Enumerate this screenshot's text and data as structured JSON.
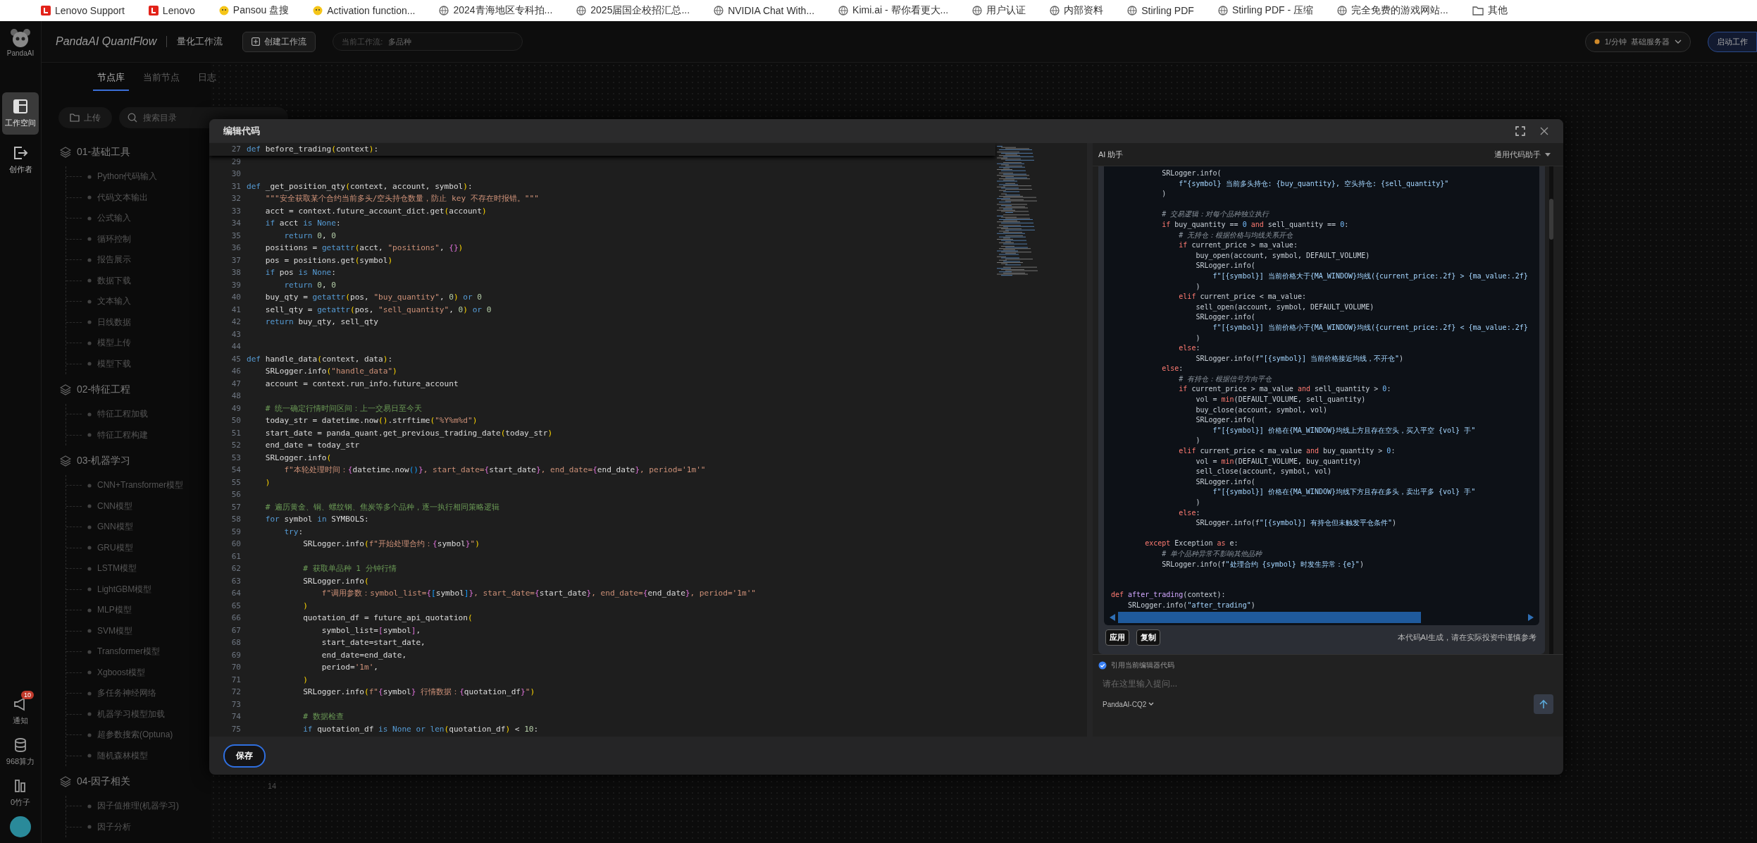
{
  "bookmarks": [
    {
      "label": "Lenovo Support",
      "kind": "square"
    },
    {
      "label": "Lenovo",
      "kind": "square"
    },
    {
      "label": "Pansou 盘搜",
      "kind": "badge"
    },
    {
      "label": "Activation function...",
      "kind": "badge"
    },
    {
      "label": "2024青海地区专科拍...",
      "kind": "globe"
    },
    {
      "label": "2025届国企校招汇总...",
      "kind": "globe"
    },
    {
      "label": "NVIDIA Chat With...",
      "kind": "globe"
    },
    {
      "label": "Kimi.ai - 帮你看更大...",
      "kind": "globe"
    },
    {
      "label": "用户认证",
      "kind": "globe"
    },
    {
      "label": "内部资料",
      "kind": "globe"
    },
    {
      "label": "Stirling PDF",
      "kind": "globe"
    },
    {
      "label": "Stirling PDF - 压缩",
      "kind": "globe"
    },
    {
      "label": "完全免费的游戏网站...",
      "kind": "globe"
    },
    {
      "label": "其他",
      "kind": "folder"
    }
  ],
  "header": {
    "logo_text": "PandaAI",
    "title": "PandaAI QuantFlow",
    "subtitle": "量化工作流",
    "create_button": "创建工作流",
    "workflow": {
      "label": "当前工作流:",
      "value": "多品种"
    },
    "server": {
      "rate": "1/分钟",
      "name": "基础服务器"
    },
    "start_button": "启动工作"
  },
  "rail": [
    {
      "label": "工作空间",
      "kind": "layout",
      "selected": true
    },
    {
      "label": "创作者",
      "kind": "exit",
      "selected": false
    }
  ],
  "rail_bottom": [
    {
      "label": "通知",
      "kind": "megaphone",
      "badge": "10"
    },
    {
      "label": "968算力",
      "kind": "database"
    },
    {
      "label": "0竹子",
      "kind": "bars"
    }
  ],
  "tabs": [
    {
      "label": "节点库",
      "selected": true
    },
    {
      "label": "当前节点",
      "selected": false
    },
    {
      "label": "日志",
      "selected": false
    }
  ],
  "upload_button": "上传",
  "search": {
    "placeholder": "搜索目录"
  },
  "tree": [
    {
      "label": "01-基础工具",
      "children": [
        {
          "label": "Python代码输入"
        },
        {
          "label": "代码文本输出"
        },
        {
          "label": "公式输入"
        },
        {
          "label": "循环控制"
        },
        {
          "label": "报告展示"
        },
        {
          "label": "数据下载"
        },
        {
          "label": "文本输入"
        },
        {
          "label": "日线数据"
        },
        {
          "label": "模型上传"
        },
        {
          "label": "模型下载"
        }
      ]
    },
    {
      "label": "02-特征工程",
      "children": [
        {
          "label": "特征工程加载"
        },
        {
          "label": "特征工程构建"
        }
      ]
    },
    {
      "label": "03-机器学习",
      "children": [
        {
          "label": "CNN+Transformer模型"
        },
        {
          "label": "CNN模型"
        },
        {
          "label": "GNN模型"
        },
        {
          "label": "GRU模型"
        },
        {
          "label": "LSTM模型"
        },
        {
          "label": "LightGBM模型"
        },
        {
          "label": "MLP模型"
        },
        {
          "label": "SVM模型"
        },
        {
          "label": "Transformer模型"
        },
        {
          "label": "Xgboost模型"
        },
        {
          "label": "多任务神经网络"
        },
        {
          "label": "机器学习模型加载"
        },
        {
          "label": "超参数搜索(Optuna)"
        },
        {
          "label": "随机森林模型"
        }
      ]
    },
    {
      "label": "04-因子相关",
      "children": [
        {
          "label": "因子值推理(机器学习)"
        },
        {
          "label": "因子分析"
        }
      ]
    }
  ],
  "canvas_label": "14",
  "modal": {
    "title": "编辑代码",
    "save_button": "保存",
    "editor": {
      "sticky_line": {
        "number": "27",
        "tokens": [
          {
            "kind": "kw",
            "text": "def"
          },
          {
            "kind": "txt",
            "text": " before_trading"
          },
          {
            "kind": "p1",
            "text": "("
          },
          {
            "kind": "txt",
            "text": "context"
          },
          {
            "kind": "p1",
            "text": ")"
          },
          {
            "kind": "txt",
            "text": ":"
          }
        ]
      },
      "lines": [
        {
          "number": "29"
        },
        {
          "number": "30"
        },
        {
          "number": "31",
          "tokens": [
            {
              "kind": "kw",
              "text": "def"
            },
            {
              "kind": "txt",
              "text": " _get_position_qty"
            },
            {
              "kind": "p1",
              "text": "("
            },
            {
              "kind": "txt",
              "text": "context, account, symbol"
            },
            {
              "kind": "p1",
              "text": ")"
            },
            {
              "kind": "txt",
              "text": ":"
            }
          ]
        },
        {
          "number": "32",
          "tokens": [
            {
              "kind": "str",
              "text": "    \"\"\"安全获取某个合约当前多头/空头持仓数量，防止 key 不存在时报错。\"\"\""
            }
          ]
        },
        {
          "number": "33",
          "tokens": [
            {
              "kind": "txt",
              "text": "    acct = context.future_account_dict.get"
            },
            {
              "kind": "p1",
              "text": "("
            },
            {
              "kind": "txt",
              "text": "account"
            },
            {
              "kind": "p1",
              "text": ")"
            }
          ]
        },
        {
          "number": "34",
          "tokens": [
            {
              "kind": "kw",
              "text": "    if"
            },
            {
              "kind": "txt",
              "text": " acct "
            },
            {
              "kind": "kw",
              "text": "is None"
            },
            {
              "kind": "txt",
              "text": ":"
            }
          ]
        },
        {
          "number": "35",
          "tokens": [
            {
              "kind": "kw",
              "text": "        return "
            },
            {
              "kind": "num",
              "text": "0"
            },
            {
              "kind": "txt",
              "text": ", "
            },
            {
              "kind": "num",
              "text": "0"
            }
          ]
        },
        {
          "number": "36",
          "tokens": [
            {
              "kind": "txt",
              "text": "    positions = "
            },
            {
              "kind": "kw",
              "text": "getattr"
            },
            {
              "kind": "p1",
              "text": "("
            },
            {
              "kind": "txt",
              "text": "acct, "
            },
            {
              "kind": "str",
              "text": "\"positions\""
            },
            {
              "kind": "txt",
              "text": ", "
            },
            {
              "kind": "p2",
              "text": "{}"
            },
            {
              "kind": "p1",
              "text": ")"
            }
          ]
        },
        {
          "number": "37",
          "tokens": [
            {
              "kind": "txt",
              "text": "    pos = positions.get"
            },
            {
              "kind": "p1",
              "text": "("
            },
            {
              "kind": "txt",
              "text": "symbol"
            },
            {
              "kind": "p1",
              "text": ")"
            }
          ]
        },
        {
          "number": "38",
          "tokens": [
            {
              "kind": "kw",
              "text": "    if"
            },
            {
              "kind": "txt",
              "text": " pos "
            },
            {
              "kind": "kw",
              "text": "is None"
            },
            {
              "kind": "txt",
              "text": ":"
            }
          ]
        },
        {
          "number": "39",
          "tokens": [
            {
              "kind": "kw",
              "text": "        return "
            },
            {
              "kind": "num",
              "text": "0"
            },
            {
              "kind": "txt",
              "text": ", "
            },
            {
              "kind": "num",
              "text": "0"
            }
          ]
        },
        {
          "number": "40",
          "tokens": [
            {
              "kind": "txt",
              "text": "    buy_qty = "
            },
            {
              "kind": "kw",
              "text": "getattr"
            },
            {
              "kind": "p1",
              "text": "("
            },
            {
              "kind": "txt",
              "text": "pos, "
            },
            {
              "kind": "str",
              "text": "\"buy_quantity\""
            },
            {
              "kind": "txt",
              "text": ", "
            },
            {
              "kind": "num",
              "text": "0"
            },
            {
              "kind": "p1",
              "text": ")"
            },
            {
              "kind": "kw",
              "text": " or "
            },
            {
              "kind": "num",
              "text": "0"
            }
          ]
        },
        {
          "number": "41",
          "tokens": [
            {
              "kind": "txt",
              "text": "    sell_qty = "
            },
            {
              "kind": "kw",
              "text": "getattr"
            },
            {
              "kind": "p1",
              "text": "("
            },
            {
              "kind": "txt",
              "text": "pos, "
            },
            {
              "kind": "str",
              "text": "\"sell_quantity\""
            },
            {
              "kind": "txt",
              "text": ", "
            },
            {
              "kind": "num",
              "text": "0"
            },
            {
              "kind": "p1",
              "text": ")"
            },
            {
              "kind": "kw",
              "text": " or "
            },
            {
              "kind": "num",
              "text": "0"
            }
          ]
        },
        {
          "number": "42",
          "tokens": [
            {
              "kind": "kw",
              "text": "    return"
            },
            {
              "kind": "txt",
              "text": " buy_qty, sell_qty"
            }
          ]
        },
        {
          "number": "43"
        },
        {
          "number": "44"
        },
        {
          "number": "45",
          "tokens": [
            {
              "kind": "kw",
              "text": "def"
            },
            {
              "kind": "txt",
              "text": " handle_data"
            },
            {
              "kind": "p1",
              "text": "("
            },
            {
              "kind": "txt",
              "text": "context, data"
            },
            {
              "kind": "p1",
              "text": ")"
            },
            {
              "kind": "txt",
              "text": ":"
            }
          ]
        },
        {
          "number": "46",
          "tokens": [
            {
              "kind": "txt",
              "text": "    SRLogger.info"
            },
            {
              "kind": "p1",
              "text": "("
            },
            {
              "kind": "str",
              "text": "\"handle_data\""
            },
            {
              "kind": "p1",
              "text": ")"
            }
          ]
        },
        {
          "number": "47",
          "tokens": [
            {
              "kind": "txt",
              "text": "    account = context.run_info.future_account"
            }
          ]
        },
        {
          "number": "48"
        },
        {
          "number": "49",
          "tokens": [
            {
              "kind": "com",
              "text": "    # 统一确定行情时间区间：上一交易日至今天"
            }
          ]
        },
        {
          "number": "50",
          "tokens": [
            {
              "kind": "txt",
              "text": "    today_str = datetime.now"
            },
            {
              "kind": "p1",
              "text": "()"
            },
            {
              "kind": "txt",
              "text": ".strftime"
            },
            {
              "kind": "p1",
              "text": "("
            },
            {
              "kind": "str",
              "text": "\"%Y%m%d\""
            },
            {
              "kind": "p1",
              "text": ")"
            }
          ]
        },
        {
          "number": "51",
          "tokens": [
            {
              "kind": "txt",
              "text": "    start_date = panda_quant.get_previous_trading_date"
            },
            {
              "kind": "p1",
              "text": "("
            },
            {
              "kind": "txt",
              "text": "today_str"
            },
            {
              "kind": "p1",
              "text": ")"
            }
          ]
        },
        {
          "number": "52",
          "tokens": [
            {
              "kind": "txt",
              "text": "    end_date = today_str"
            }
          ]
        },
        {
          "number": "53",
          "tokens": [
            {
              "kind": "txt",
              "text": "    SRLogger.info"
            },
            {
              "kind": "p1",
              "text": "("
            }
          ]
        },
        {
          "number": "54",
          "tokens": [
            {
              "kind": "str",
              "text": "        f\"本轮处理时间："
            },
            {
              "kind": "p2",
              "text": "{"
            },
            {
              "kind": "txt",
              "text": "datetime.now"
            },
            {
              "kind": "p3",
              "text": "()"
            },
            {
              "kind": "p2",
              "text": "}"
            },
            {
              "kind": "str",
              "text": ", start_date="
            },
            {
              "kind": "p2",
              "text": "{"
            },
            {
              "kind": "txt",
              "text": "start_date"
            },
            {
              "kind": "p2",
              "text": "}"
            },
            {
              "kind": "str",
              "text": ", end_date="
            },
            {
              "kind": "p2",
              "text": "{"
            },
            {
              "kind": "txt",
              "text": "end_date"
            },
            {
              "kind": "p2",
              "text": "}"
            },
            {
              "kind": "str",
              "text": ", period='1m'\""
            }
          ]
        },
        {
          "number": "55",
          "tokens": [
            {
              "kind": "p1",
              "text": "    )"
            }
          ]
        },
        {
          "number": "56"
        },
        {
          "number": "57",
          "tokens": [
            {
              "kind": "com",
              "text": "    # 遍历黄金、铜、螺纹钢、焦炭等多个品种，逐一执行相同策略逻辑"
            }
          ]
        },
        {
          "number": "58",
          "tokens": [
            {
              "kind": "kw",
              "text": "    for"
            },
            {
              "kind": "txt",
              "text": " symbol "
            },
            {
              "kind": "kw",
              "text": "in"
            },
            {
              "kind": "txt",
              "text": " SYMBOLS:"
            }
          ]
        },
        {
          "number": "59",
          "tokens": [
            {
              "kind": "kw",
              "text": "        try"
            },
            {
              "kind": "txt",
              "text": ":"
            }
          ]
        },
        {
          "number": "60",
          "tokens": [
            {
              "kind": "txt",
              "text": "            SRLogger.info"
            },
            {
              "kind": "p1",
              "text": "("
            },
            {
              "kind": "str",
              "text": "f\"开始处理合约："
            },
            {
              "kind": "p2",
              "text": "{"
            },
            {
              "kind": "txt",
              "text": "symbol"
            },
            {
              "kind": "p2",
              "text": "}"
            },
            {
              "kind": "str",
              "text": "\""
            },
            {
              "kind": "p1",
              "text": ")"
            }
          ]
        },
        {
          "number": "61"
        },
        {
          "number": "62",
          "tokens": [
            {
              "kind": "com",
              "text": "            # 获取单品种 1 分钟行情"
            }
          ]
        },
        {
          "number": "63",
          "tokens": [
            {
              "kind": "txt",
              "text": "            SRLogger.info"
            },
            {
              "kind": "p1",
              "text": "("
            }
          ]
        },
        {
          "number": "64",
          "tokens": [
            {
              "kind": "str",
              "text": "                f\"调用参数：symbol_list="
            },
            {
              "kind": "p2",
              "text": "{"
            },
            {
              "kind": "p3",
              "text": "["
            },
            {
              "kind": "txt",
              "text": "symbol"
            },
            {
              "kind": "p3",
              "text": "]"
            },
            {
              "kind": "p2",
              "text": "}"
            },
            {
              "kind": "str",
              "text": ", start_date="
            },
            {
              "kind": "p2",
              "text": "{"
            },
            {
              "kind": "txt",
              "text": "start_date"
            },
            {
              "kind": "p2",
              "text": "}"
            },
            {
              "kind": "str",
              "text": ", end_date="
            },
            {
              "kind": "p2",
              "text": "{"
            },
            {
              "kind": "txt",
              "text": "end_date"
            },
            {
              "kind": "p2",
              "text": "}"
            },
            {
              "kind": "str",
              "text": ", period='1m'\""
            }
          ]
        },
        {
          "number": "65",
          "tokens": [
            {
              "kind": "p1",
              "text": "            )"
            }
          ]
        },
        {
          "number": "66",
          "tokens": [
            {
              "kind": "txt",
              "text": "            quotation_df = future_api_quotation"
            },
            {
              "kind": "p1",
              "text": "("
            }
          ]
        },
        {
          "number": "67",
          "tokens": [
            {
              "kind": "txt",
              "text": "                symbol_list="
            },
            {
              "kind": "p2",
              "text": "["
            },
            {
              "kind": "txt",
              "text": "symbol"
            },
            {
              "kind": "p2",
              "text": "]"
            },
            {
              "kind": "txt",
              "text": ","
            }
          ]
        },
        {
          "number": "68",
          "tokens": [
            {
              "kind": "txt",
              "text": "                start_date=start_date,"
            }
          ]
        },
        {
          "number": "69",
          "tokens": [
            {
              "kind": "txt",
              "text": "                end_date=end_date,"
            }
          ]
        },
        {
          "number": "70",
          "tokens": [
            {
              "kind": "txt",
              "text": "                period="
            },
            {
              "kind": "str",
              "text": "'1m'"
            },
            {
              "kind": "txt",
              "text": ","
            }
          ]
        },
        {
          "number": "71",
          "tokens": [
            {
              "kind": "p1",
              "text": "            )"
            }
          ]
        },
        {
          "number": "72",
          "tokens": [
            {
              "kind": "txt",
              "text": "            SRLogger.info"
            },
            {
              "kind": "p1",
              "text": "("
            },
            {
              "kind": "str",
              "text": "f\""
            },
            {
              "kind": "p2",
              "text": "{"
            },
            {
              "kind": "txt",
              "text": "symbol"
            },
            {
              "kind": "p2",
              "text": "}"
            },
            {
              "kind": "str",
              "text": " 行情数据："
            },
            {
              "kind": "p2",
              "text": "{"
            },
            {
              "kind": "txt",
              "text": "quotation_df"
            },
            {
              "kind": "p2",
              "text": "}"
            },
            {
              "kind": "str",
              "text": "\""
            },
            {
              "kind": "p1",
              "text": ")"
            }
          ]
        },
        {
          "number": "73"
        },
        {
          "number": "74",
          "tokens": [
            {
              "kind": "com",
              "text": "            # 数据检查"
            }
          ]
        },
        {
          "number": "75",
          "tokens": [
            {
              "kind": "kw",
              "text": "            if"
            },
            {
              "kind": "txt",
              "text": " quotation_df "
            },
            {
              "kind": "kw",
              "text": "is None or len"
            },
            {
              "kind": "p1",
              "text": "("
            },
            {
              "kind": "txt",
              "text": "quotation_df"
            },
            {
              "kind": "p1",
              "text": ")"
            },
            {
              "kind": "txt",
              "text": " < "
            },
            {
              "kind": "num",
              "text": "10"
            },
            {
              "kind": "txt",
              "text": ":"
            }
          ]
        }
      ]
    },
    "assistant": {
      "title": "AI 助手",
      "mode": "通用代码助手",
      "code": [
        {
          "kind": "code",
          "tokens": [
            {
              "kind": "txt",
              "text": "            SRLogger.info("
            }
          ]
        },
        {
          "kind": "code",
          "tokens": [
            {
              "kind": "str",
              "text": "                f\"{symbol} 当前多头持仓: {buy_quantity}, 空头持仓: {sell_quantity}\""
            }
          ]
        },
        {
          "kind": "code",
          "tokens": [
            {
              "kind": "txt",
              "text": "            )"
            }
          ]
        },
        {
          "kind": "blank"
        },
        {
          "kind": "code",
          "tokens": [
            {
              "kind": "com",
              "text": "            # 交易逻辑：对每个品种独立执行"
            }
          ]
        },
        {
          "kind": "code",
          "tokens": [
            {
              "kind": "kw",
              "text": "            if"
            },
            {
              "kind": "txt",
              "text": " buy_quantity == "
            },
            {
              "kind": "num",
              "text": "0"
            },
            {
              "kind": "kw",
              "text": " and"
            },
            {
              "kind": "txt",
              "text": " sell_quantity == "
            },
            {
              "kind": "num",
              "text": "0"
            },
            {
              "kind": "txt",
              "text": ":"
            }
          ]
        },
        {
          "kind": "code",
          "tokens": [
            {
              "kind": "com",
              "text": "                # 无持仓：根据价格与均线关系开仓"
            }
          ]
        },
        {
          "kind": "code",
          "tokens": [
            {
              "kind": "kw",
              "text": "                if"
            },
            {
              "kind": "txt",
              "text": " current_price > ma_value:"
            }
          ]
        },
        {
          "kind": "code",
          "tokens": [
            {
              "kind": "txt",
              "text": "                    buy_open(account, symbol, DEFAULT_VOLUME)"
            }
          ]
        },
        {
          "kind": "code",
          "tokens": [
            {
              "kind": "txt",
              "text": "                    SRLogger.info("
            }
          ]
        },
        {
          "kind": "code",
          "tokens": [
            {
              "kind": "str",
              "text": "                        f\"[{symbol}] 当前价格大于{MA_WINDOW}均线({current_price:.2f} > {ma_value:.2f}"
            }
          ]
        },
        {
          "kind": "code",
          "tokens": [
            {
              "kind": "txt",
              "text": "                    )"
            }
          ]
        },
        {
          "kind": "code",
          "tokens": [
            {
              "kind": "kw",
              "text": "                elif"
            },
            {
              "kind": "txt",
              "text": " current_price < ma_value:"
            }
          ]
        },
        {
          "kind": "code",
          "tokens": [
            {
              "kind": "txt",
              "text": "                    sell_open(account, symbol, DEFAULT_VOLUME)"
            }
          ]
        },
        {
          "kind": "code",
          "tokens": [
            {
              "kind": "txt",
              "text": "                    SRLogger.info("
            }
          ]
        },
        {
          "kind": "code",
          "tokens": [
            {
              "kind": "str",
              "text": "                        f\"[{symbol}] 当前价格小于{MA_WINDOW}均线({current_price:.2f} < {ma_value:.2f}"
            }
          ]
        },
        {
          "kind": "code",
          "tokens": [
            {
              "kind": "txt",
              "text": "                    )"
            }
          ]
        },
        {
          "kind": "code",
          "tokens": [
            {
              "kind": "kw",
              "text": "                else"
            },
            {
              "kind": "txt",
              "text": ":"
            }
          ]
        },
        {
          "kind": "code",
          "tokens": [
            {
              "kind": "txt",
              "text": "                    SRLogger.info(f"
            },
            {
              "kind": "str",
              "text": "\"[{symbol}] 当前价格接近均线，不开仓\""
            },
            {
              "kind": "txt",
              "text": ")"
            }
          ]
        },
        {
          "kind": "code",
          "tokens": [
            {
              "kind": "kw",
              "text": "            else"
            },
            {
              "kind": "txt",
              "text": ":"
            }
          ]
        },
        {
          "kind": "code",
          "tokens": [
            {
              "kind": "com",
              "text": "                # 有持仓：根据信号方向平仓"
            }
          ]
        },
        {
          "kind": "code",
          "tokens": [
            {
              "kind": "kw",
              "text": "                if"
            },
            {
              "kind": "txt",
              "text": " current_price > ma_value "
            },
            {
              "kind": "kw",
              "text": "and"
            },
            {
              "kind": "txt",
              "text": " sell_quantity > "
            },
            {
              "kind": "num",
              "text": "0"
            },
            {
              "kind": "txt",
              "text": ":"
            }
          ]
        },
        {
          "kind": "code",
          "tokens": [
            {
              "kind": "txt",
              "text": "                    vol = "
            },
            {
              "kind": "kw",
              "text": "min"
            },
            {
              "kind": "txt",
              "text": "(DEFAULT_VOLUME, sell_quantity)"
            }
          ]
        },
        {
          "kind": "code",
          "tokens": [
            {
              "kind": "txt",
              "text": "                    buy_close(account, symbol, vol)"
            }
          ]
        },
        {
          "kind": "code",
          "tokens": [
            {
              "kind": "txt",
              "text": "                    SRLogger.info("
            }
          ]
        },
        {
          "kind": "code",
          "tokens": [
            {
              "kind": "str",
              "text": "                        f\"[{symbol}] 价格在{MA_WINDOW}均线上方且存在空头，买入平空 {vol} 手\""
            }
          ]
        },
        {
          "kind": "code",
          "tokens": [
            {
              "kind": "txt",
              "text": "                    )"
            }
          ]
        },
        {
          "kind": "code",
          "tokens": [
            {
              "kind": "kw",
              "text": "                elif"
            },
            {
              "kind": "txt",
              "text": " current_price < ma_value "
            },
            {
              "kind": "kw",
              "text": "and"
            },
            {
              "kind": "txt",
              "text": " buy_quantity > "
            },
            {
              "kind": "num",
              "text": "0"
            },
            {
              "kind": "txt",
              "text": ":"
            }
          ]
        },
        {
          "kind": "code",
          "tokens": [
            {
              "kind": "txt",
              "text": "                    vol = "
            },
            {
              "kind": "kw",
              "text": "min"
            },
            {
              "kind": "txt",
              "text": "(DEFAULT_VOLUME, buy_quantity)"
            }
          ]
        },
        {
          "kind": "code",
          "tokens": [
            {
              "kind": "txt",
              "text": "                    sell_close(account, symbol, vol)"
            }
          ]
        },
        {
          "kind": "code",
          "tokens": [
            {
              "kind": "txt",
              "text": "                    SRLogger.info("
            }
          ]
        },
        {
          "kind": "code",
          "tokens": [
            {
              "kind": "str",
              "text": "                        f\"[{symbol}] 价格在{MA_WINDOW}均线下方且存在多头，卖出平多 {vol} 手\""
            }
          ]
        },
        {
          "kind": "code",
          "tokens": [
            {
              "kind": "txt",
              "text": "                    )"
            }
          ]
        },
        {
          "kind": "code",
          "tokens": [
            {
              "kind": "kw",
              "text": "                else"
            },
            {
              "kind": "txt",
              "text": ":"
            }
          ]
        },
        {
          "kind": "code",
          "tokens": [
            {
              "kind": "txt",
              "text": "                    SRLogger.info(f"
            },
            {
              "kind": "str",
              "text": "\"[{symbol}] 有持仓但未触发平仓条件\""
            },
            {
              "kind": "txt",
              "text": ")"
            }
          ]
        },
        {
          "kind": "blank"
        },
        {
          "kind": "code",
          "tokens": [
            {
              "kind": "kw",
              "text": "        except"
            },
            {
              "kind": "txt",
              "text": " Exception "
            },
            {
              "kind": "kw",
              "text": "as"
            },
            {
              "kind": "txt",
              "text": " e:"
            }
          ]
        },
        {
          "kind": "code",
          "tokens": [
            {
              "kind": "com",
              "text": "            # 单个品种异常不影响其他品种"
            }
          ]
        },
        {
          "kind": "code",
          "tokens": [
            {
              "kind": "txt",
              "text": "            SRLogger.info(f"
            },
            {
              "kind": "str",
              "text": "\"处理合约 {symbol} 时发生异常：{e}\""
            },
            {
              "kind": "txt",
              "text": ")"
            }
          ]
        },
        {
          "kind": "blank"
        },
        {
          "kind": "blank"
        },
        {
          "kind": "code",
          "tokens": [
            {
              "kind": "kw",
              "text": "def"
            },
            {
              "kind": "fn",
              "text": " after_trading"
            },
            {
              "kind": "txt",
              "text": "(context):"
            }
          ]
        },
        {
          "kind": "code",
          "tokens": [
            {
              "kind": "txt",
              "text": "    SRLogger.info("
            },
            {
              "kind": "str",
              "text": "\"after_trading\""
            },
            {
              "kind": "txt",
              "text": ")"
            }
          ]
        }
      ],
      "apply_button": "应用",
      "copy_button": "复制",
      "note": "本代码AI生成，请在实际投资中谨慎参考",
      "use_editor_code": {
        "label": "引用当前编辑器代码",
        "checked": true
      },
      "input": {
        "placeholder": "请在这里输入提问..."
      },
      "model": "PandaAI-CQ2"
    }
  }
}
